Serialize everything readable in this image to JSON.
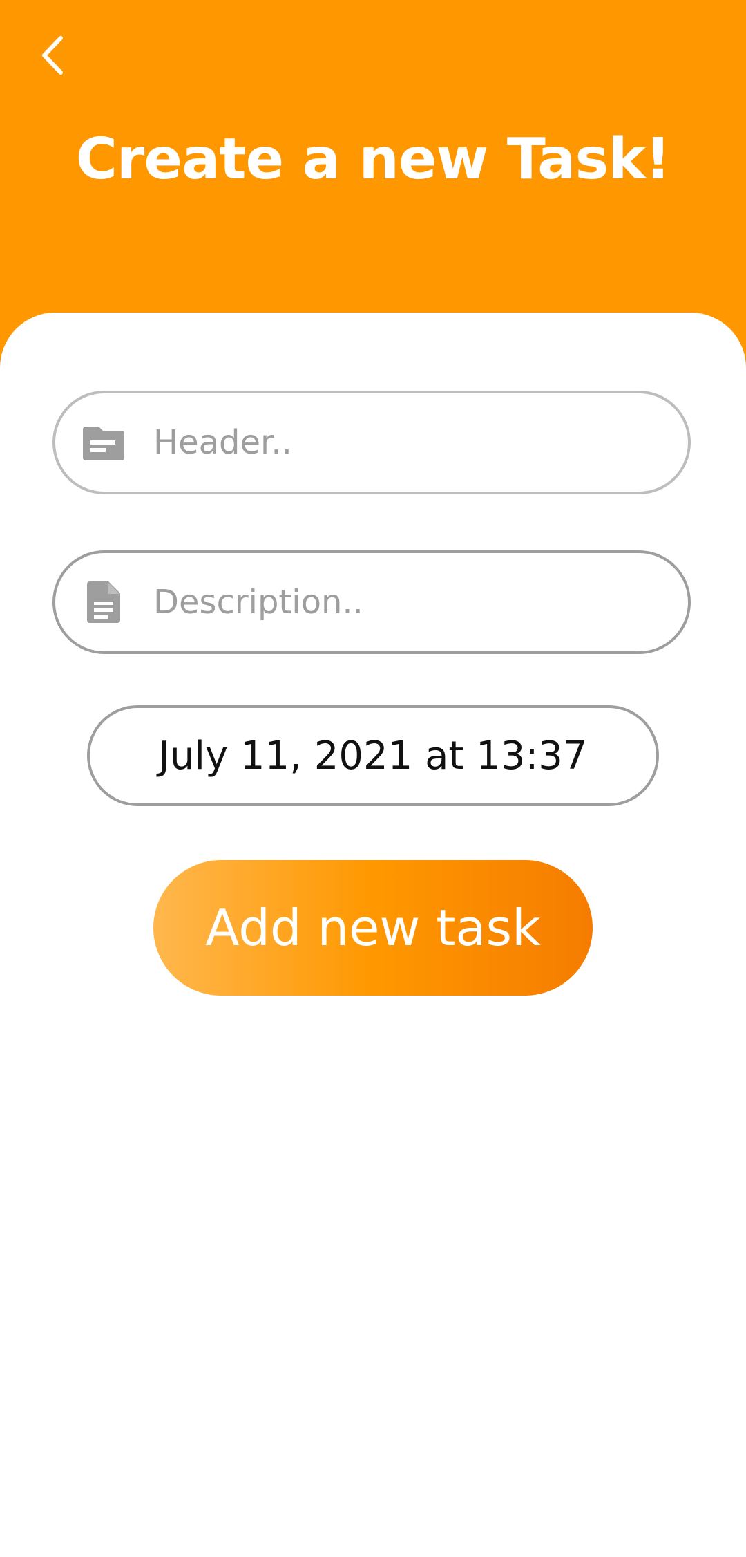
{
  "colors": {
    "accent": "#FF9800",
    "accent_dark": "#F57C00",
    "accent_light": "#FFB74D",
    "card_bg": "#FFFFFF",
    "border": "#9E9E9E",
    "icon": "#9E9E9E"
  },
  "header": {
    "back_icon": "chevron-left-icon",
    "title": "Create a new Task!"
  },
  "form": {
    "header_field": {
      "icon": "folder-icon",
      "placeholder": "Header..",
      "value": ""
    },
    "description_field": {
      "icon": "document-icon",
      "placeholder": "Description..",
      "value": ""
    },
    "date": "July 11, 2021 at 13:37",
    "add_button_label": "Add new task"
  }
}
